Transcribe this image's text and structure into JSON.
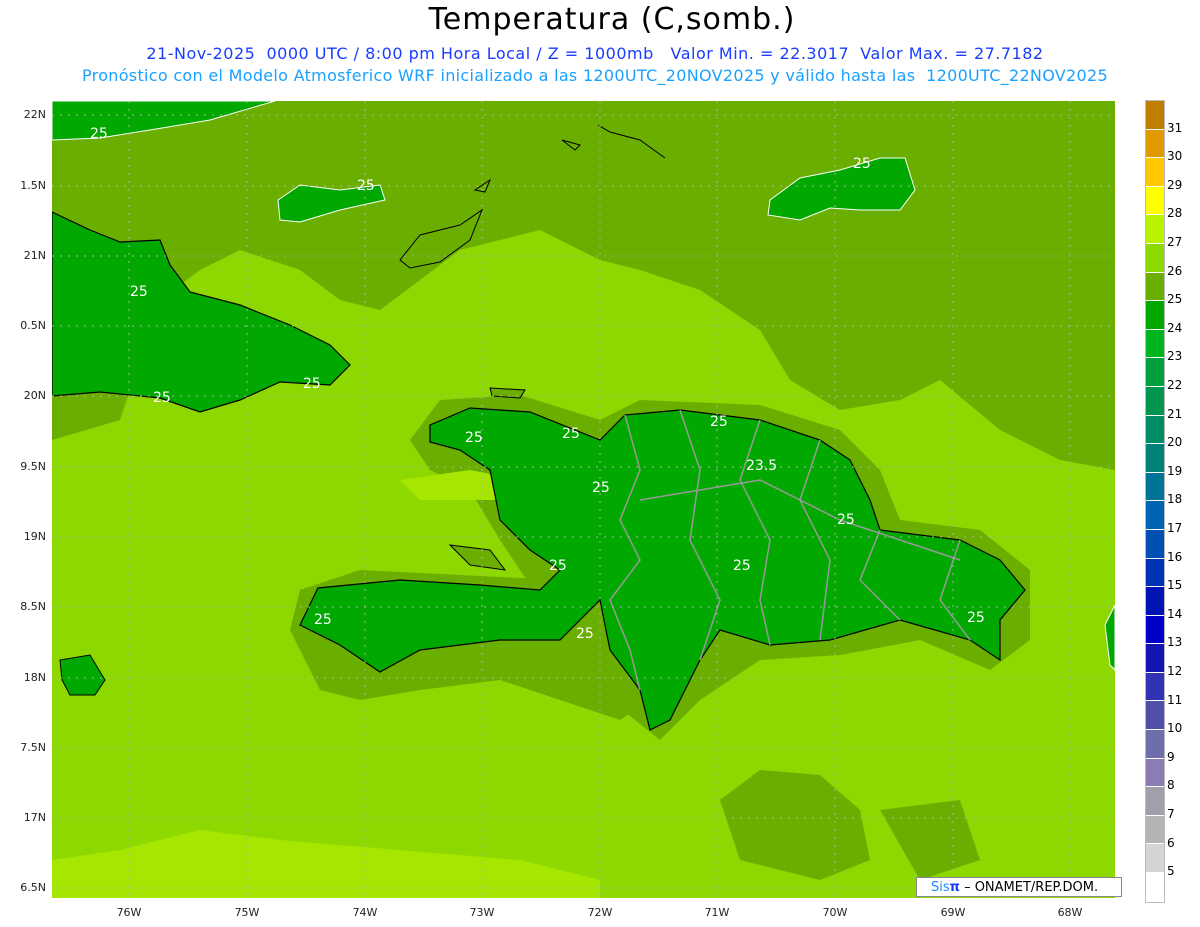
{
  "header": {
    "title": "Temperatura (C,somb.)",
    "subtitle_1": "21-Nov-2025  0000 UTC / 8:00 pm Hora Local / Z = 1000mb   Valor Min. = 22.3017  Valor Max. = 27.7182",
    "subtitle_2": "Pronóstico con el Modelo Atmosferico WRF inicializado a las 1200UTC_20NOV2025 y válido hasta las  1200UTC_22NOV2025"
  },
  "axes": {
    "lat_labels": [
      "22N",
      "1.5N",
      "21N",
      "0.5N",
      "20N",
      "9.5N",
      "19N",
      "8.5N",
      "18N",
      "7.5N",
      "17N",
      "6.5N"
    ],
    "lon_labels": [
      "76W",
      "75W",
      "74W",
      "73W",
      "72W",
      "71W",
      "70W",
      "69W",
      "68W"
    ]
  },
  "contour_labels": [
    "25",
    "25",
    "25",
    "25",
    "25",
    "25",
    "25",
    "25",
    "25",
    "25",
    "25",
    "25",
    "25",
    "23.5",
    "25",
    "25",
    "25",
    "25",
    "25"
  ],
  "colorbar": {
    "labels": [
      "31",
      "30",
      "29",
      "28",
      "27",
      "26",
      "25",
      "24",
      "23",
      "22",
      "21",
      "20",
      "19",
      "18",
      "17",
      "16",
      "15",
      "14",
      "13",
      "12",
      "11",
      "10",
      "9",
      "8",
      "7",
      "6",
      "5"
    ],
    "colors": [
      "#c07e00",
      "#e09a00",
      "#ffc800",
      "#ffff00",
      "#b8f200",
      "#8cd800",
      "#6aae00",
      "#00a800",
      "#00b41e",
      "#00a03c",
      "#009650",
      "#008c64",
      "#008278",
      "#007496",
      "#0064b4",
      "#0050b4",
      "#0032b4",
      "#0014b4",
      "#0000c8",
      "#1414b4",
      "#3232b4",
      "#5050aa",
      "#6e6eaa",
      "#8c7cb4",
      "#a0a0aa",
      "#b4b4b4",
      "#d4d4d4",
      "#ffffff"
    ]
  },
  "credit": {
    "sis": "Sis",
    "pi": "π",
    "text": " – ONAMET/REP.DOM."
  }
}
